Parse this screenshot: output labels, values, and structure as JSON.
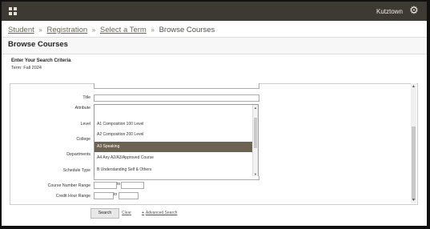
{
  "topbar": {
    "institution": "Kutztown"
  },
  "breadcrumb": {
    "items": [
      "Student",
      "Registration",
      "Select a Term"
    ],
    "current": "Browse Courses",
    "separator": "»"
  },
  "page": {
    "title": "Browse Courses"
  },
  "criteria": {
    "heading": "Enter Your Search Criteria",
    "term": "Term: Fall 2024"
  },
  "form": {
    "labels": {
      "title": "Title",
      "attribute": "Attribute",
      "level": "Level",
      "college": "College",
      "departments": "Departments",
      "schedule_type": "Schedule Type",
      "course_number_range": "Course Number Range",
      "credit_hour_range": "Credit Hour Range",
      "to": "to"
    },
    "attribute_options": [
      "A1 Composition 100 Level",
      "A2 Composition 200 Level",
      "A3 Speaking",
      "A4 Any A2/A3/Approved Course",
      "B Understanding Self & Others"
    ],
    "selected_option": "A3 Speaking"
  },
  "actions": {
    "search": "Search",
    "clear": "Clear",
    "advanced": "Advanced Search",
    "advanced_prefix": "+"
  }
}
